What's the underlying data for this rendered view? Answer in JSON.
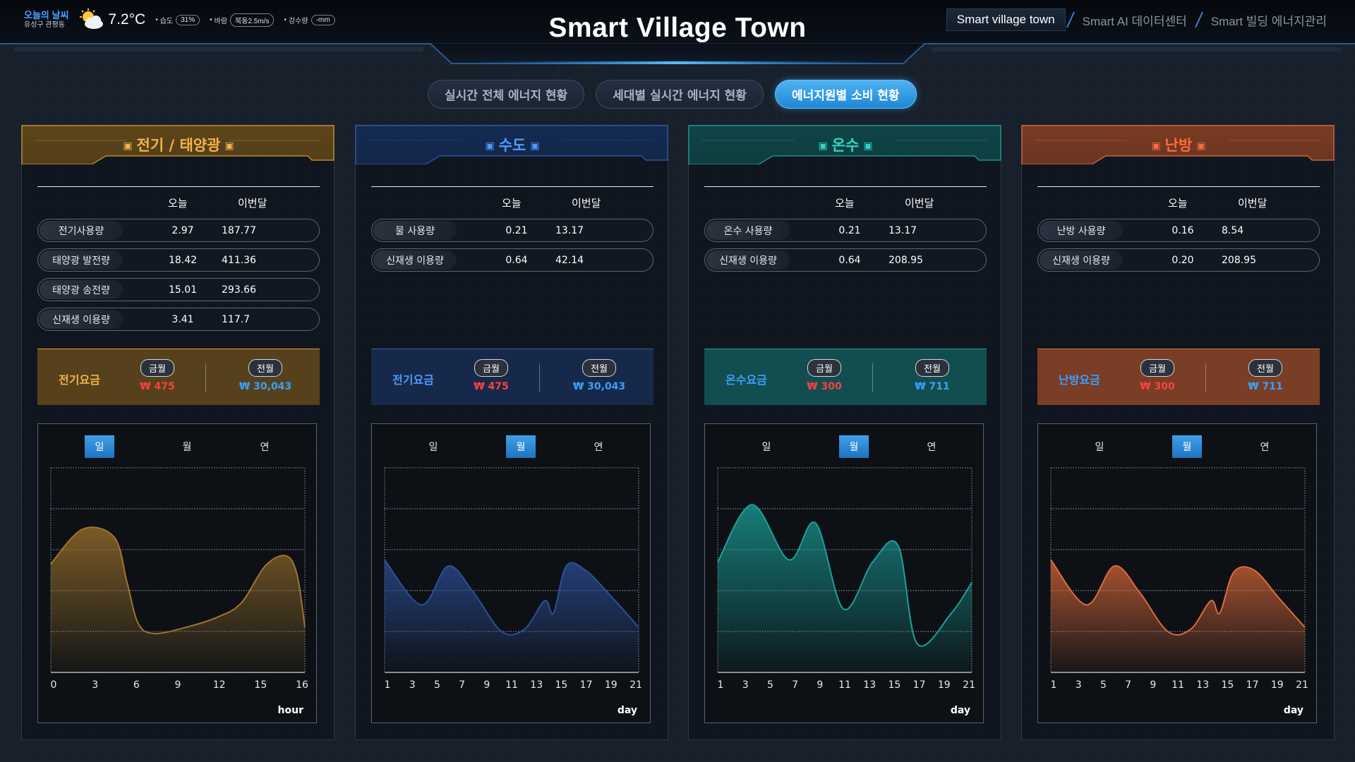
{
  "header": {
    "title": "Smart Village Town",
    "weather": {
      "title": "오늘의 날씨",
      "location": "유성구 관평동",
      "icon": "partly-cloudy-icon",
      "temperature": "7.2°C",
      "humidity_label": "습도",
      "humidity_value": "31%",
      "wind_label": "바람",
      "wind_value": "북동2.5m/s",
      "rain_label": "강수량",
      "rain_value": "-mm"
    },
    "nav": [
      "Smart village town",
      "Smart AI 데이터센터",
      "Smart 빌딩 에너지관리"
    ]
  },
  "tabs": [
    "실시간 전체 에너지 현황",
    "세대별 실시간 에너지 현황",
    "에너지원별 소비 현황"
  ],
  "active_tab": 2,
  "common": {
    "col_today": "오늘",
    "col_month": "이번달",
    "badge_current": "금월",
    "badge_prev": "전월",
    "period_tabs": [
      "일",
      "월",
      "연"
    ]
  },
  "panels": [
    {
      "title": "전기 / 태양광",
      "theme": {
        "head": "#5e4519",
        "accent": "#d99a31",
        "title_color": "#f0b449",
        "line": "#a0742b",
        "bill_bg": "#56411c"
      },
      "rows": [
        {
          "label": "전기사용량",
          "today": "2.97",
          "month": "187.77"
        },
        {
          "label": "태양광 발전량",
          "today": "18.42",
          "month": "411.36"
        },
        {
          "label": "태양광 송전량",
          "today": "15.01",
          "month": "293.66"
        },
        {
          "label": "신재생 이용량",
          "today": "3.41",
          "month": "117.7"
        }
      ],
      "bill": {
        "label": "전기요금",
        "label_color": "#f0b449",
        "current": "₩ 475",
        "prev": "₩ 30,043",
        "current_color": "#ff4040",
        "prev_color": "#3aa0ff"
      },
      "active_period": 0,
      "unit": "hour"
    },
    {
      "title": "수도",
      "theme": {
        "head": "#142a52",
        "accent": "#2f5db0",
        "title_color": "#4f9bff",
        "line": "#2d4f9a",
        "bill_bg": "#16294a"
      },
      "rows": [
        {
          "label": "물 사용량",
          "today": "0.21",
          "month": "13.17"
        },
        {
          "label": "신재생 이용량",
          "today": "0.64",
          "month": "42.14"
        }
      ],
      "bill": {
        "label": "전기요금",
        "label_color": "#4f9bff",
        "current": "₩ 475",
        "prev": "₩ 30,043",
        "current_color": "#ff4040",
        "prev_color": "#3aa0ff"
      },
      "active_period": 1,
      "unit": "day"
    },
    {
      "title": "온수",
      "theme": {
        "head": "#0f4446",
        "accent": "#1fa59c",
        "title_color": "#31d7c6",
        "line": "#1aa19a",
        "bill_bg": "#124e4f"
      },
      "rows": [
        {
          "label": "온수 사용량",
          "today": "0.21",
          "month": "13.17"
        },
        {
          "label": "신재생 이용량",
          "today": "0.64",
          "month": "208.95"
        }
      ],
      "bill": {
        "label": "온수요금",
        "label_color": "#3aa0ff",
        "current": "₩ 300",
        "prev": "₩ 711",
        "current_color": "#ff4040",
        "prev_color": "#3aa0ff"
      },
      "active_period": 1,
      "unit": "day"
    },
    {
      "title": "난방",
      "theme": {
        "head": "#7a3b22",
        "accent": "#e0703f",
        "title_color": "#ff6a3c",
        "line": "#e06a3a",
        "bill_bg": "#7a3d25"
      },
      "rows": [
        {
          "label": "난방 사용량",
          "today": "0.16",
          "month": "8.54"
        },
        {
          "label": "신재생 이용량",
          "today": "0.20",
          "month": "208.95"
        }
      ],
      "bill": {
        "label": "난방요금",
        "label_color": "#3aa0ff",
        "current": "₩ 300",
        "prev": "₩ 711",
        "current_color": "#ff4040",
        "prev_color": "#3aa0ff"
      },
      "active_period": 1,
      "unit": "day"
    }
  ],
  "chart_data": [
    {
      "type": "area",
      "title": "",
      "xlabel": "hour",
      "x_ticks": [
        "0",
        "3",
        "6",
        "9",
        "12",
        "15",
        "16"
      ],
      "x": [
        0,
        2,
        4,
        4.8,
        5.5,
        6.5,
        8.5,
        10.5,
        12,
        13.5,
        14.8,
        15.5,
        16
      ],
      "values": [
        2.65,
        3.5,
        3.3,
        2.2,
        1.2,
        0.95,
        1.1,
        1.35,
        1.7,
        2.6,
        2.85,
        2.4,
        1.1
      ],
      "ylim": [
        0,
        5
      ],
      "grid": true
    },
    {
      "type": "area",
      "title": "",
      "xlabel": "day",
      "x_ticks": [
        "1",
        "3",
        "5",
        "7",
        "9",
        "11",
        "13",
        "15",
        "17",
        "19",
        "21"
      ],
      "x": [
        1,
        3.9,
        6,
        8,
        10.2,
        12,
        13.6,
        14.3,
        15.3,
        16.8,
        19,
        21
      ],
      "values": [
        2.75,
        1.65,
        2.6,
        1.95,
        1.0,
        1.05,
        1.75,
        1.45,
        2.6,
        2.5,
        1.8,
        1.1
      ],
      "ylim": [
        0,
        5
      ],
      "grid": true
    },
    {
      "type": "area",
      "title": "",
      "xlabel": "day",
      "x_ticks": [
        "1",
        "3",
        "5",
        "7",
        "9",
        "11",
        "13",
        "15",
        "17",
        "19",
        "21"
      ],
      "x": [
        1,
        3.7,
        6.6,
        8.7,
        10.9,
        13.2,
        15.2,
        16.7,
        19.4,
        21
      ],
      "values": [
        2.7,
        4.1,
        2.75,
        3.65,
        1.55,
        2.7,
        3.1,
        0.7,
        1.45,
        2.2
      ],
      "ylim": [
        0,
        5
      ],
      "grid": true
    },
    {
      "type": "area",
      "title": "",
      "xlabel": "day",
      "x_ticks": [
        "1",
        "3",
        "5",
        "7",
        "9",
        "11",
        "13",
        "15",
        "17",
        "19",
        "21"
      ],
      "x": [
        1,
        3.8,
        6,
        8,
        10.2,
        12,
        13.6,
        14.3,
        15.4,
        17,
        19,
        21
      ],
      "values": [
        2.75,
        1.65,
        2.6,
        1.95,
        1.0,
        1.05,
        1.75,
        1.45,
        2.45,
        2.5,
        1.8,
        1.1
      ],
      "ylim": [
        0,
        5
      ],
      "grid": true
    }
  ]
}
